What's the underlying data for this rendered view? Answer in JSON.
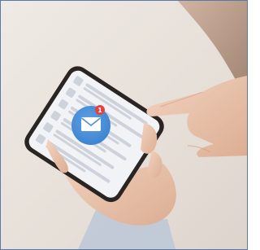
{
  "image": {
    "subject": "hand-holding-phone-with-mail-notification",
    "icon": "envelope-icon",
    "colors": {
      "frame_border": "#5b79a6",
      "background": "#e9e3dd",
      "phone_body": "#2a2523",
      "screen": "#f2f3f6",
      "mail_circle": "#4a90d9",
      "notification_badge": "#e8413b",
      "skin": "#e9c4ad"
    },
    "badge": {
      "count": "1"
    }
  }
}
